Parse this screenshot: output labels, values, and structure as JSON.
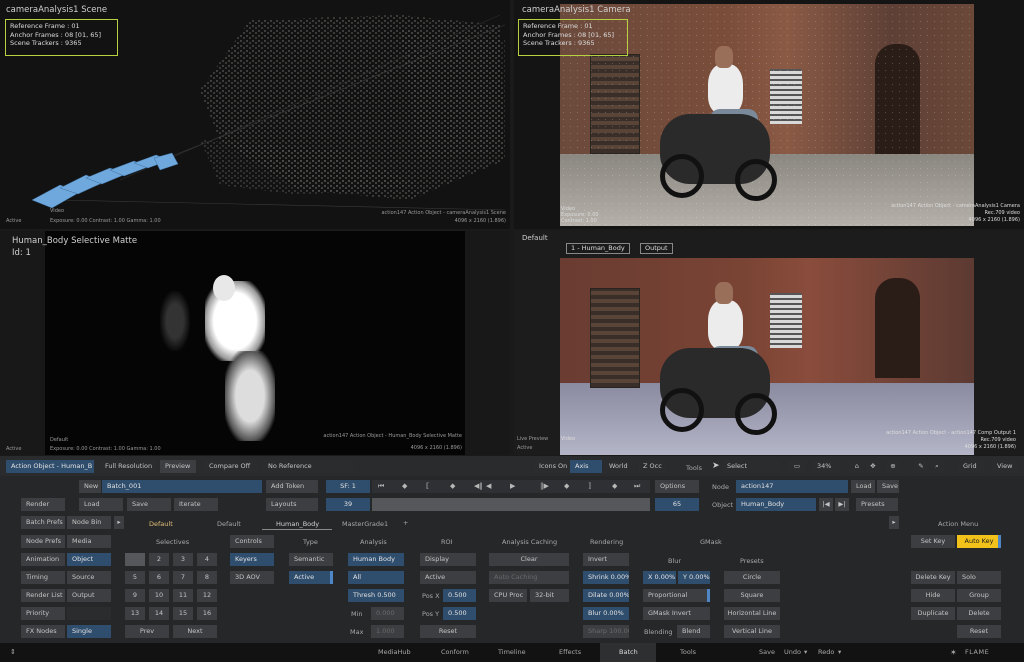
{
  "viewports": {
    "top_left": {
      "title": "cameraAnalysis1 Scene",
      "info": [
        "Reference Frame : 01",
        "Anchor Frames : 08 [01, 65]",
        "Scene Trackers : 9365"
      ],
      "video_label": "Video",
      "status": "Active",
      "stats": "Exposure: 0.00     Contrast: 1.00     Gamma: 1.00",
      "footer1": "action147 Action Object - cameraAnalysis1 Scene",
      "footer2": "4096 x 2160 (1.896)"
    },
    "top_right": {
      "title": "cameraAnalysis1 Camera",
      "info": [
        "Reference Frame : 01",
        "Anchor Frames : 08 [01, 65]",
        "Scene Trackers : 9365"
      ],
      "left1": "Video",
      "left2": "Exposure: 0.00",
      "left3": "Contrast: 1.00",
      "footer1": "action147 Action Object - cameraAnalysis1 Camera",
      "footer2": "Rec.709 video",
      "footer3": "4096 x 2160 (1.896)"
    },
    "bottom_left": {
      "title": "Human_Body Selective Matte",
      "id": "Id: 1",
      "default_label": "Default",
      "status": "Active",
      "stats": "Exposure: 0.00     Contrast: 1.00     Gamma: 1.00",
      "footer1": "action147 Action Object - Human_Body Selective Matte",
      "footer2": "4096 x 2160 (1.896)"
    },
    "bottom_right": {
      "label": "Default",
      "tag1": "1 - Human_Body",
      "tag2": "Output",
      "left1": "Live Preview",
      "left2": "Video",
      "left3": "Active",
      "footer1": "action147 Action Object - action147 Comp Output 1",
      "footer2": "Rec.709 video",
      "footer3": "4096 x 2160 (1.896)"
    }
  },
  "toolbar": {
    "object": "Action Object - Human_B",
    "full_res": "Full Resolution",
    "preview": "Preview",
    "compare": "Compare Off",
    "reference": "No Reference",
    "icons_on": "Icons On",
    "axis": "Axis",
    "world": "World",
    "zacc": "Z Occ",
    "tools": "Tools",
    "select": "Select",
    "zoom": "34%",
    "grid": "Grid",
    "view": "View"
  },
  "row1": {
    "new": "New",
    "batch_name": "Batch_001",
    "add_token": "Add Token",
    "sf": "SF: 1",
    "options": "Options",
    "node_label": "Node",
    "node_name": "action147",
    "load": "Load",
    "save": "Save"
  },
  "row2": {
    "render": "Render",
    "load": "Load",
    "save": "Save",
    "iterate": "Iterate",
    "layouts": "Layouts",
    "frame": "39",
    "end": "65",
    "object_label": "Object",
    "object_name": "Human_Body",
    "presets": "Presets"
  },
  "row3": {
    "batch_prefs": "Batch Prefs",
    "node_bin": "Node Bin",
    "tabs": [
      "Default",
      "Default",
      "Human_Body",
      "MasterGrade1"
    ],
    "plus": "+"
  },
  "left_menu": {
    "col1": [
      "Node Prefs",
      "Animation",
      "Timing",
      "Render List",
      "Priority",
      "FX Nodes"
    ],
    "col2": [
      "Media",
      "Object",
      "Source",
      "Output",
      "",
      "Single"
    ]
  },
  "selectives": {
    "header": "Selectives",
    "cells": [
      "",
      "2",
      "3",
      "4",
      "5",
      "6",
      "7",
      "8",
      "9",
      "10",
      "11",
      "12",
      "13",
      "14",
      "15",
      "16"
    ],
    "prev": "Prev",
    "next": "Next"
  },
  "controls": {
    "header": "Controls",
    "keyers": "Keyers",
    "aov": "3D AOV"
  },
  "type": {
    "header": "Type",
    "semantic": "Semantic",
    "active": "Active"
  },
  "analysis": {
    "header": "Analysis",
    "human_body": "Human Body",
    "all": "All",
    "thresh": "Thresh 0.500",
    "min_label": "Min",
    "min_value": "0.000",
    "max_label": "Max",
    "max_value": "1.000"
  },
  "roi": {
    "header": "ROI",
    "display": "Display",
    "active": "Active",
    "posx_label": "Pos X",
    "posx": "0.500",
    "posy_label": "Pos Y",
    "posy": "0.500",
    "reset": "Reset"
  },
  "caching": {
    "header": "Analysis Caching",
    "clear": "Clear",
    "auto": "Auto Caching",
    "cpu": "CPU Proc",
    "bit": "32-bit"
  },
  "rendering": {
    "header": "Rendering",
    "invert": "Invert",
    "shrink": "Shrink 0.00%",
    "dilate": "Dilate 0.00%",
    "blur": "Blur 0.00%",
    "sharp": "Sharp 100.00"
  },
  "gmask": {
    "header": "GMask",
    "blur_header": "Blur",
    "x": "X 0.00%",
    "y": "Y 0.00%",
    "proportional": "Proportional",
    "invert": "GMask Invert",
    "blending_label": "Blending",
    "blend": "Blend"
  },
  "presets": {
    "header": "Presets",
    "items": [
      "Circle",
      "Square",
      "Horizontal Line",
      "Vertical Line"
    ]
  },
  "action_menu": {
    "header": "Action Menu",
    "set_key": "Set Key",
    "auto_key": "Auto Key",
    "delete_key": "Delete Key",
    "solo": "Solo",
    "hide": "Hide",
    "group": "Group",
    "duplicate": "Duplicate",
    "delete": "Delete",
    "reset": "Reset"
  },
  "bottom_tabs": [
    "MediaHub",
    "Conform",
    "Timeline",
    "Effects",
    "Batch",
    "Tools"
  ],
  "bottom_right": {
    "save": "Save",
    "undo": "Undo",
    "redo": "Redo",
    "flame": "FLAME"
  },
  "colors": {
    "accent_blue": "#4f86c6",
    "selected": "#2f4d6d",
    "auto_key": "#f2c21b",
    "info_border": "#b7d23e",
    "gold": "#e4c07a"
  }
}
